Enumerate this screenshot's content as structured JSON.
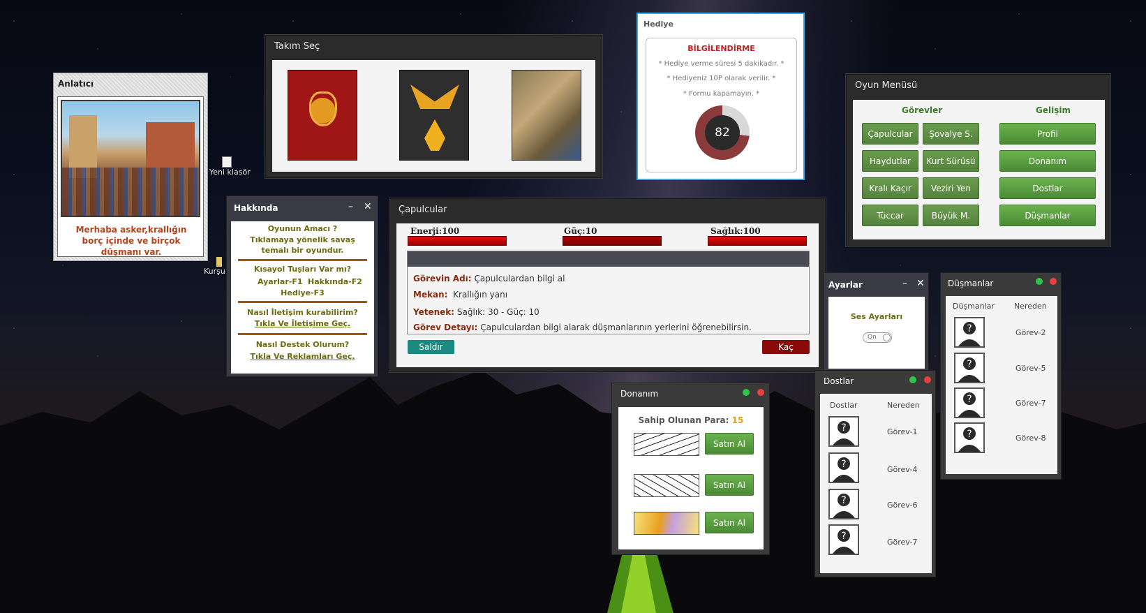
{
  "desktop": {
    "icons": [
      {
        "label": "Yeni klasör"
      },
      {
        "label": "Kurşu"
      }
    ]
  },
  "anlatici": {
    "title": "Anlatıcı",
    "message": "Merhaba asker,krallığın borç içinde ve birçok düşmanı var."
  },
  "takim_sec": {
    "title": "Takım Seç",
    "cards": [
      {
        "name": "dragon-emblem"
      },
      {
        "name": "phoenix-emblem"
      },
      {
        "name": "warrior-lion"
      }
    ]
  },
  "hediye": {
    "title": "Hediye",
    "heading": "BİLGİLENDİRME",
    "lines": [
      "* Hediye verme süresi 5 dakikadır. *",
      "* Hediyeniz 10P olarak verilir. *",
      "* Formu kapamayın. *"
    ],
    "countdown": "82",
    "progress_fraction": 0.27,
    "colors": {
      "ring": "#8a3a3a",
      "ring_track": "#d8d8d8",
      "center": "#2a2a2a"
    }
  },
  "oyun_menusu": {
    "title": "Oyun Menüsü",
    "gorevler_header": "Görevler",
    "gelisim_header": "Gelişim",
    "gorevler": [
      [
        "Çapulcular",
        "Şovalye S."
      ],
      [
        "Haydutlar",
        "Kurt Sürüsü"
      ],
      [
        "Kralı Kaçır",
        "Veziri Yen"
      ],
      [
        "Tüccar",
        "Büyük M."
      ]
    ],
    "gelisim": [
      "Profil",
      "Donanım",
      "Dostlar",
      "Düşmanlar"
    ]
  },
  "hakkinda": {
    "title": "Hakkında",
    "minimize": "–",
    "close": "✕",
    "q1": "Oyunun Amacı ?",
    "a1_line1": "Tıklamaya yönelik savaş",
    "a1_line2": "temalı bir oyundur.",
    "q2": "Kısayol Tuşları Var mı?",
    "k1": "Ayarlar-F1",
    "k2": "Hakkında-F2",
    "k3": "Hediye-F3",
    "q3": "Nasıl İletişim kurabilirim?",
    "link1": "Tıkla Ve İletişime Geç.",
    "q4": "Nasıl Destek Olurum?",
    "link2": "Tıkla Ve Reklamları Geç."
  },
  "capulcular": {
    "title": "Çapulcular",
    "stats": [
      {
        "label": "Enerji:",
        "value": "100",
        "fraction": 1.0
      },
      {
        "label": "Güç:",
        "value": "10",
        "fraction": 1.0
      },
      {
        "label": "Sağlık:",
        "value": "100",
        "fraction": 1.0
      }
    ],
    "gorev_adi_label": "Görevin Adı:",
    "gorev_adi": "Çapulculardan bilgi al",
    "mekan_label": "Mekan:",
    "mekan": "Krallığın yanı",
    "yetenek_label": "Yetenek:",
    "yetenek": "Sağlık:  30  -  Güç: 10",
    "detay_label": "Görev Detayı:",
    "detay": "Çapulculardan bilgi  alarak düşmanlarının yerlerini öğrenebilirsin.",
    "saldir": "Saldır",
    "kac": "Kaç"
  },
  "ayarlar": {
    "title": "Ayarlar",
    "minimize": "–",
    "close": "✕",
    "label": "Ses Ayarları",
    "toggle": "On"
  },
  "dusmanlar": {
    "title": "Düşmanlar",
    "col1": "Düşmanlar",
    "col2": "Nereden",
    "rows": [
      "Görev-2",
      "Görev-5",
      "Görev-7",
      "Görev-8"
    ]
  },
  "dostlar": {
    "title": "Dostlar",
    "col1": "Dostlar",
    "col2": "Nereden",
    "rows": [
      "Görev-1",
      "Görev-4",
      "Görev-6",
      "Görev-7"
    ]
  },
  "donanim": {
    "title": "Donanım",
    "para_label": "Sahip Olunan Para:",
    "para": "15",
    "buy": [
      "Satın Al",
      "Satın Al",
      "Satın Al"
    ]
  },
  "colors": {
    "title_bar": "#2b2b2b",
    "green": "#5aa042",
    "teal": "#1a8a80",
    "dark_red": "#8a0a0a",
    "gold": "#e0a020"
  }
}
